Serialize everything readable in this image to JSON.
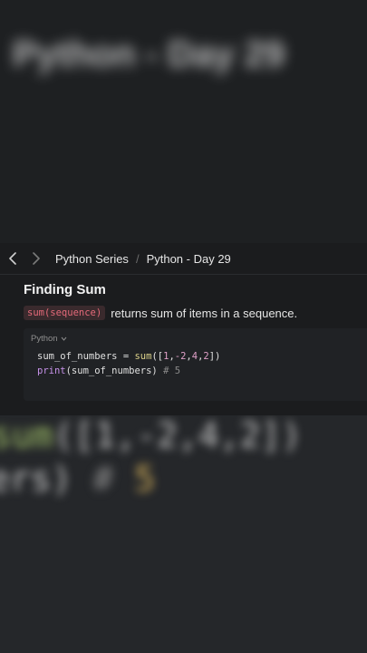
{
  "background": {
    "title_text": "Python - Day 29",
    "code_line_1": {
      "fn": "sum",
      "args": "([1,-2,4,2])"
    },
    "code_line_2": {
      "start": "ers)",
      "comment": "#",
      "value": "5"
    }
  },
  "breadcrumb": {
    "back_icon": "chevron-left-icon",
    "forward_icon": "chevron-right-icon",
    "parent": "Python Series",
    "separator": "/",
    "current": "Python - Day 29"
  },
  "content": {
    "heading": "Finding Sum",
    "inline_code": "sum(sequence)",
    "description": "returns sum of items in a sequence."
  },
  "code_block": {
    "language": "Python",
    "lines": [
      {
        "var": "sum_of_numbers",
        "op": " = ",
        "fn": "sum",
        "open": "([",
        "n1": "1",
        "c1": ",",
        "n2": "-2",
        "c2": ",",
        "n3": "4",
        "c3": ",",
        "n4": "2",
        "close": "])"
      },
      {
        "fn": "print",
        "arg": "(sum_of_numbers)",
        "comment": " # 5"
      }
    ]
  },
  "colors": {
    "accent_code": "#e56a7a",
    "inline_code_bg": "#3a2a2d",
    "panel_bg": "#1b1c1e"
  }
}
